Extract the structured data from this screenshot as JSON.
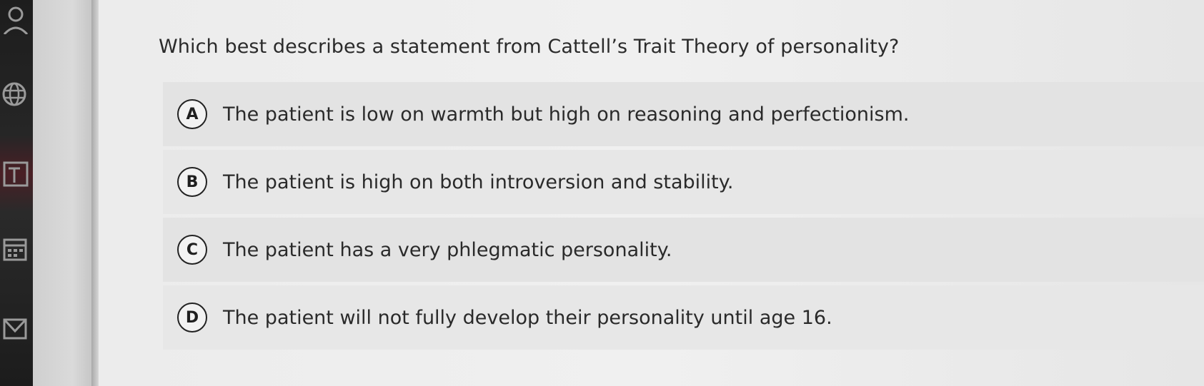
{
  "question": {
    "text": "Which best describes a statement from Cattell’s Trait Theory of personality?"
  },
  "options": [
    {
      "letter": "A",
      "text": "The patient is low on warmth but high on reasoning and perfectionism."
    },
    {
      "letter": "B",
      "text": "The patient is high on both introversion and stability."
    },
    {
      "letter": "C",
      "text": "The patient has a very phlegmatic personality."
    },
    {
      "letter": "D",
      "text": "The patient will not fully develop their personality until age 16."
    }
  ],
  "sidebar": {
    "icons": [
      "user-icon",
      "globe-icon",
      "text-icon",
      "calendar-icon",
      "mail-icon"
    ]
  },
  "colors": {
    "sidebar_bg": "#1d1d1d",
    "panel_bg": "#eeeeee",
    "option_bg": "#e3e3e3",
    "text": "#2b2b2b"
  }
}
